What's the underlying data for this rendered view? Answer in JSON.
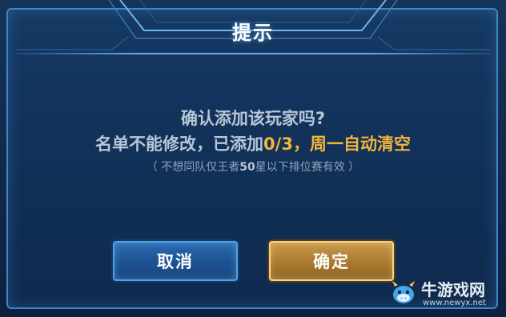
{
  "dialog": {
    "title": "提示",
    "message_line1": "确认添加该玩家吗?",
    "message_line2_prefix": "名单不能修改，已添加",
    "message_line2_count": "0/3",
    "message_line2_suffix": "，周一自动清空",
    "note_prefix": "（ 不想同队仅王者",
    "note_stars": "50",
    "note_suffix": "星以下排位赛有效 ）"
  },
  "buttons": {
    "cancel_label": "取消",
    "confirm_label": "确定"
  },
  "watermark": {
    "name": "牛游戏网",
    "url": "www.newyx.net",
    "logo_icon": "cow-mascot-icon"
  },
  "colors": {
    "highlight": "#f2b53a",
    "cancel_button": "#1d5291",
    "confirm_button": "#a9792f",
    "dialog_border": "#3f86c7"
  }
}
